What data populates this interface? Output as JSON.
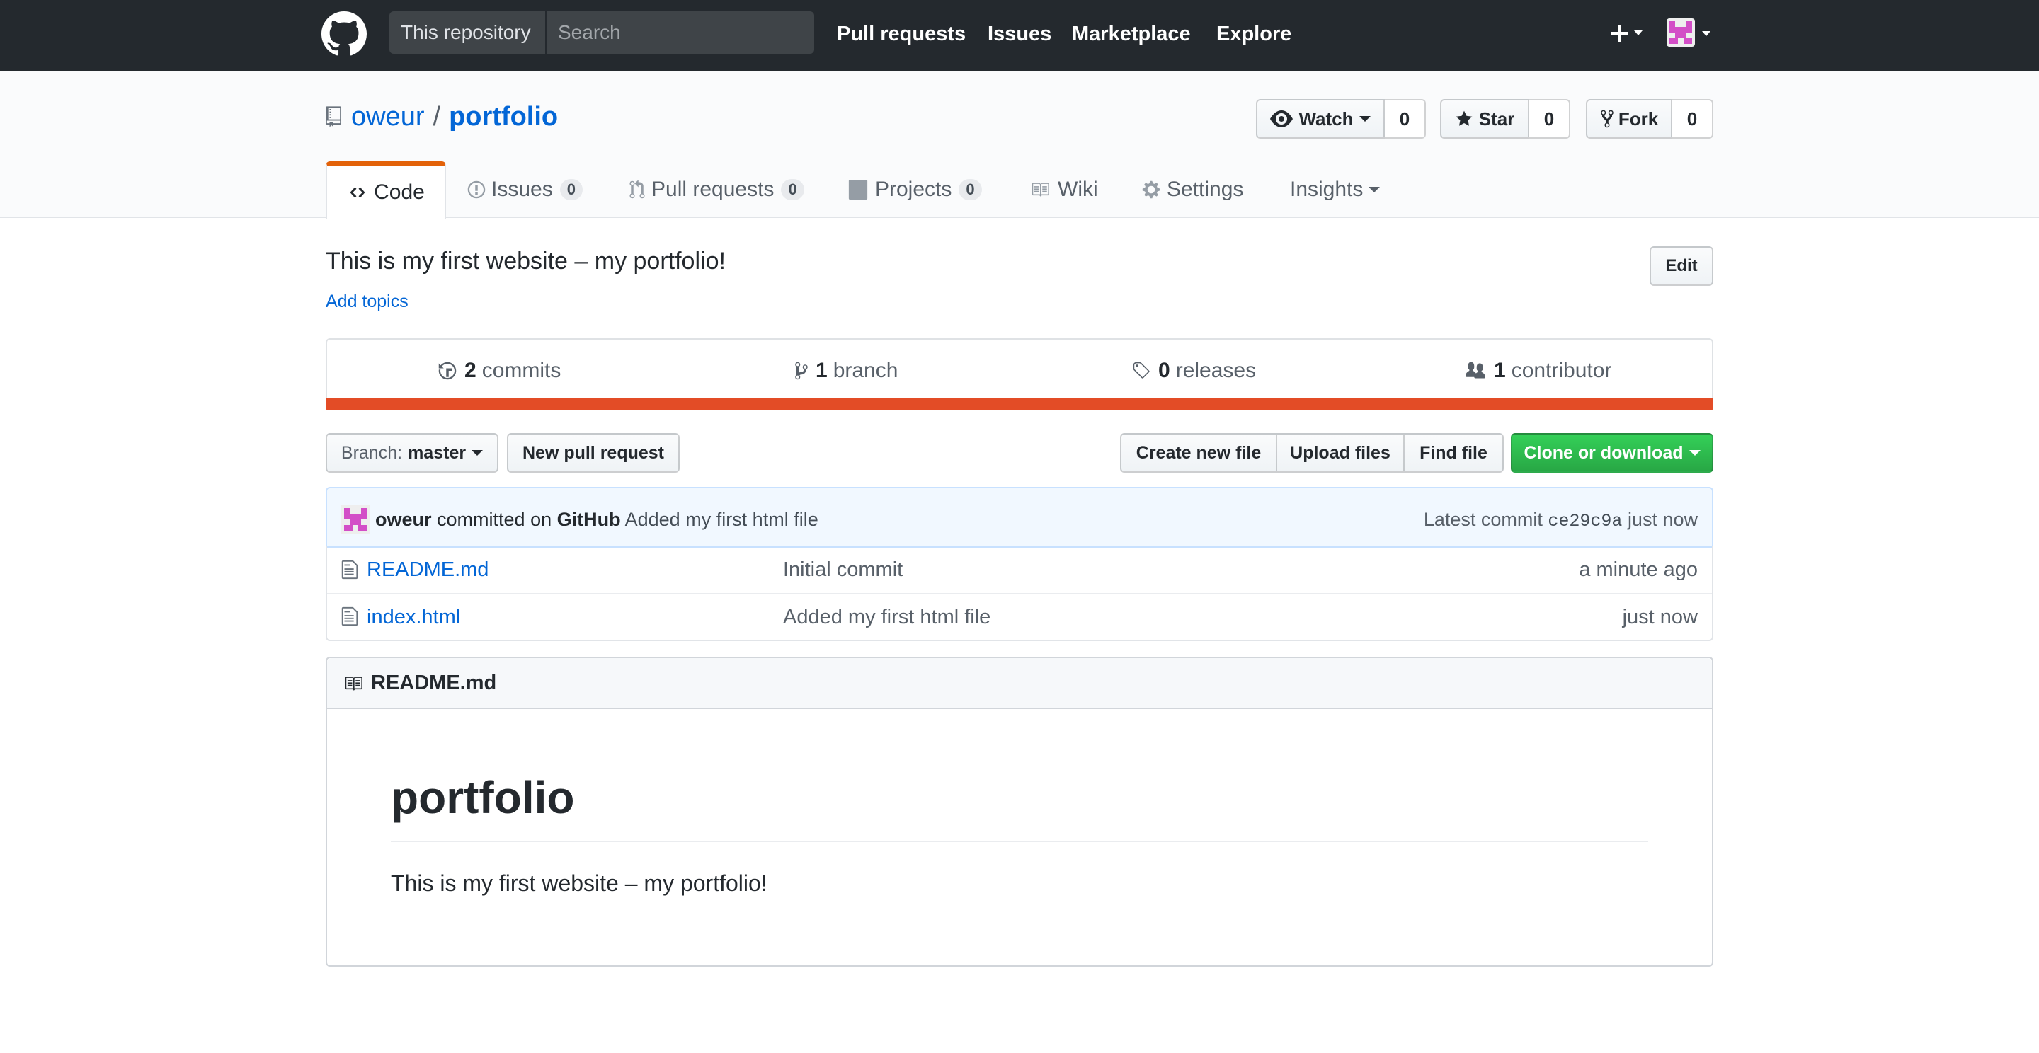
{
  "header": {
    "search_scope": "This repository",
    "search_placeholder": "Search",
    "nav": [
      "Pull requests",
      "Issues",
      "Marketplace",
      "Explore"
    ],
    "bg_color": "#24292e"
  },
  "repo": {
    "owner": "oweur",
    "separator": "/",
    "name": "portfolio",
    "watch_label": "Watch",
    "watch_count": "0",
    "star_label": "Star",
    "star_count": "0",
    "fork_label": "Fork",
    "fork_count": "0"
  },
  "tabs": [
    {
      "label": "Code",
      "icon": "code-icon"
    },
    {
      "label": "Issues",
      "count": "0",
      "icon": "issue-icon"
    },
    {
      "label": "Pull requests",
      "count": "0",
      "icon": "pull-request-icon"
    },
    {
      "label": "Projects",
      "count": "0",
      "icon": "project-icon"
    },
    {
      "label": "Wiki",
      "icon": "book-icon"
    },
    {
      "label": "Settings",
      "icon": "gear-icon"
    },
    {
      "label": "Insights"
    }
  ],
  "description": {
    "text": "This is my first website – my portfolio!",
    "add_topics": "Add topics",
    "edit_label": "Edit"
  },
  "summary": {
    "commits_count": "2",
    "commits_label": "commits",
    "branch_count": "1",
    "branch_label": "branch",
    "releases_count": "0",
    "releases_label": "releases",
    "contributor_count": "1",
    "contributor_label": "contributor",
    "language_color": "#e34c26"
  },
  "file_nav": {
    "branch_prefix": "Branch:",
    "branch_name": "master",
    "new_pull_request": "New pull request",
    "create_new_file": "Create new file",
    "upload_files": "Upload files",
    "find_file": "Find file",
    "clone_or_download": "Clone or download"
  },
  "latest_commit": {
    "author": "oweur",
    "committed_on": "committed on",
    "committer": "GitHub",
    "message": "Added my first html file",
    "latest_label": "Latest commit",
    "sha": "ce29c9a",
    "age": "just now"
  },
  "files": [
    {
      "name": "README.md",
      "message": "Initial commit",
      "age": "a minute ago"
    },
    {
      "name": "index.html",
      "message": "Added my first html file",
      "age": "just now"
    }
  ],
  "readme": {
    "filename": "README.md",
    "heading": "portfolio",
    "body": "This is my first website – my portfolio!"
  }
}
